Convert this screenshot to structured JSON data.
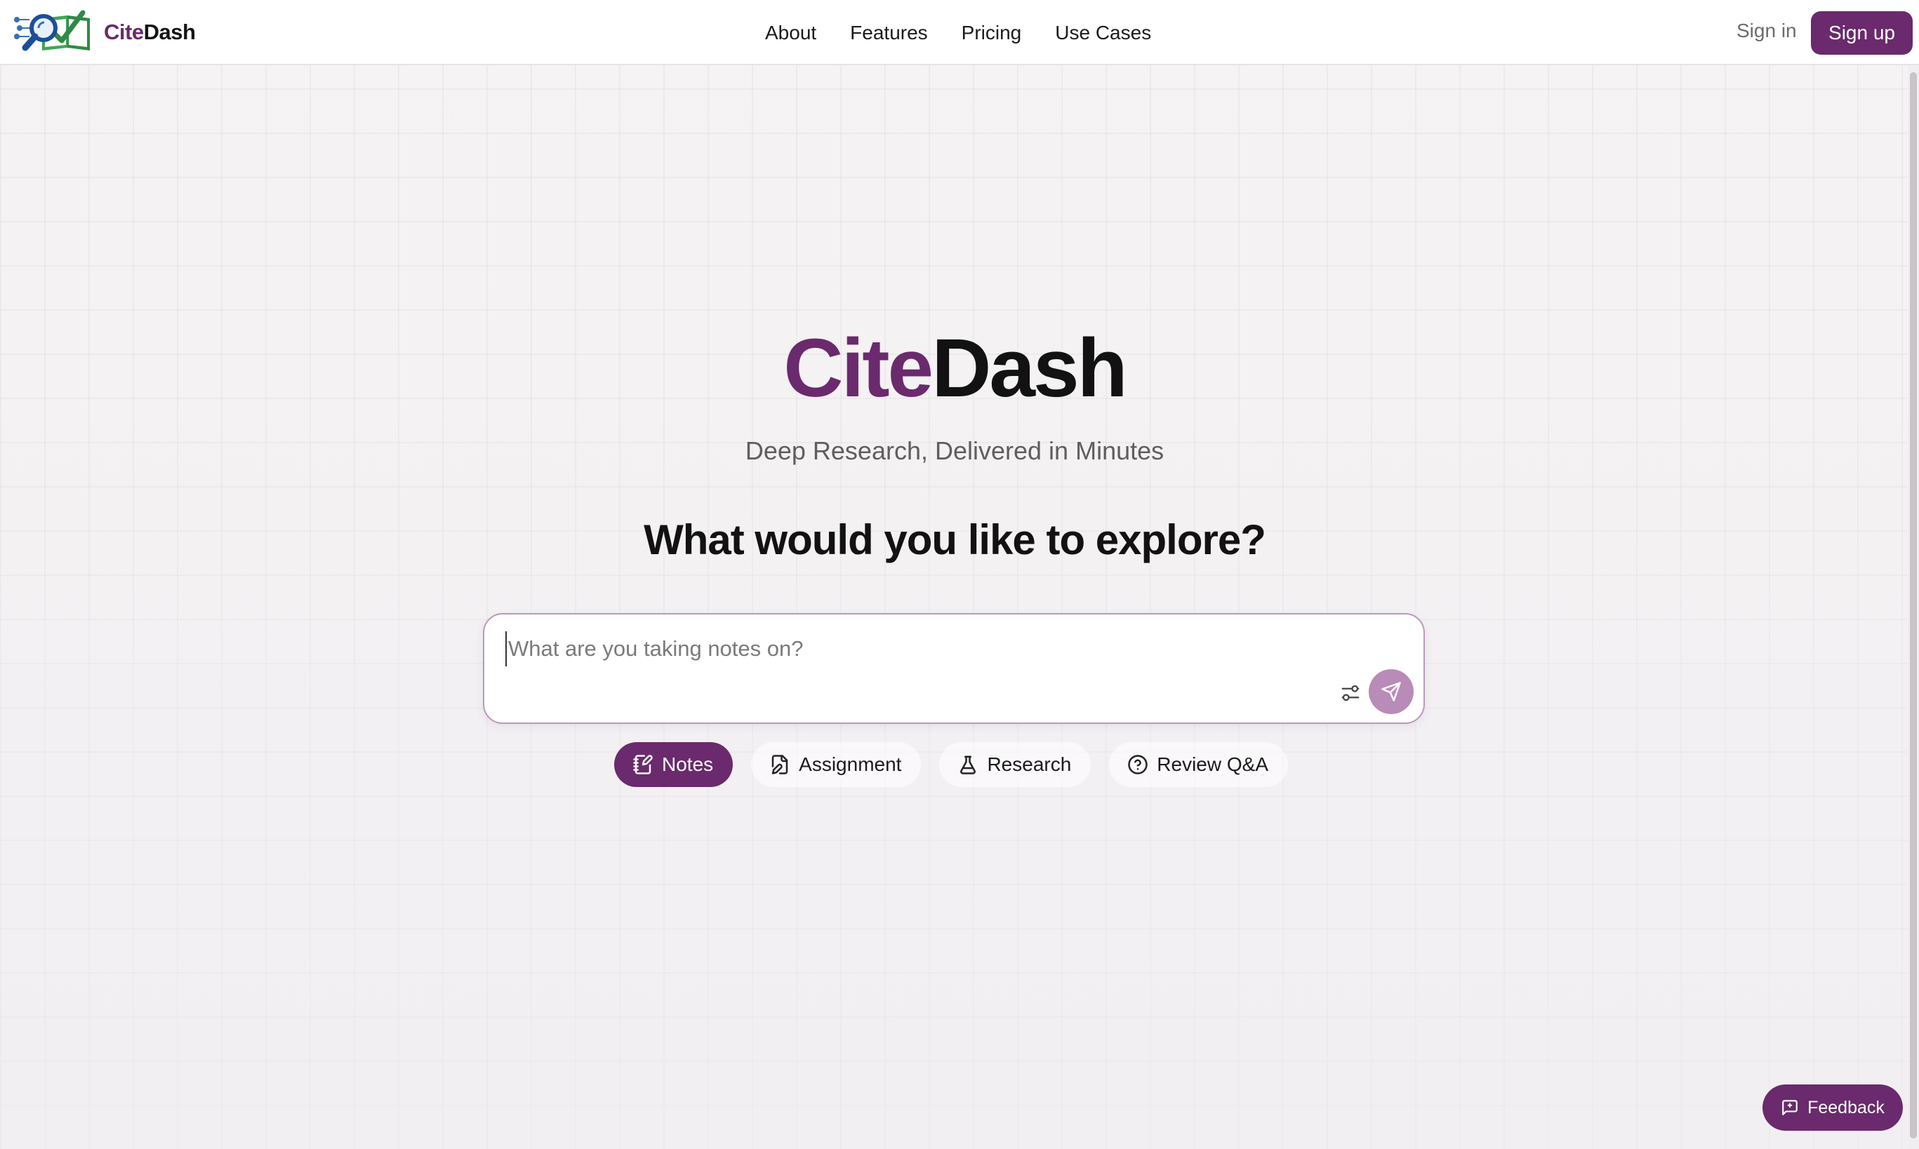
{
  "brand": {
    "name_part1": "Cite",
    "name_part2": "Dash"
  },
  "nav": {
    "links": [
      "About",
      "Features",
      "Pricing",
      "Use Cases"
    ],
    "signin_label": "Sign in",
    "signup_label": "Sign up"
  },
  "hero": {
    "title_part1": "Cite",
    "title_part2": "Dash",
    "subtitle": "Deep Research, Delivered in Minutes",
    "question": "What would you like to explore?"
  },
  "search": {
    "placeholder": "What are you taking notes on?",
    "value": ""
  },
  "modes": [
    {
      "label": "Notes",
      "icon": "notebook-pen-icon",
      "active": true
    },
    {
      "label": "Assignment",
      "icon": "file-pen-icon",
      "active": false
    },
    {
      "label": "Research",
      "icon": "flask-icon",
      "active": false
    },
    {
      "label": "Review Q&A",
      "icon": "help-circle-icon",
      "active": false
    }
  ],
  "feedback": {
    "label": "Feedback",
    "icon": "message-square-icon"
  },
  "colors": {
    "brand_purple": "#6a2a6d",
    "send_button": "#b88bb9"
  }
}
